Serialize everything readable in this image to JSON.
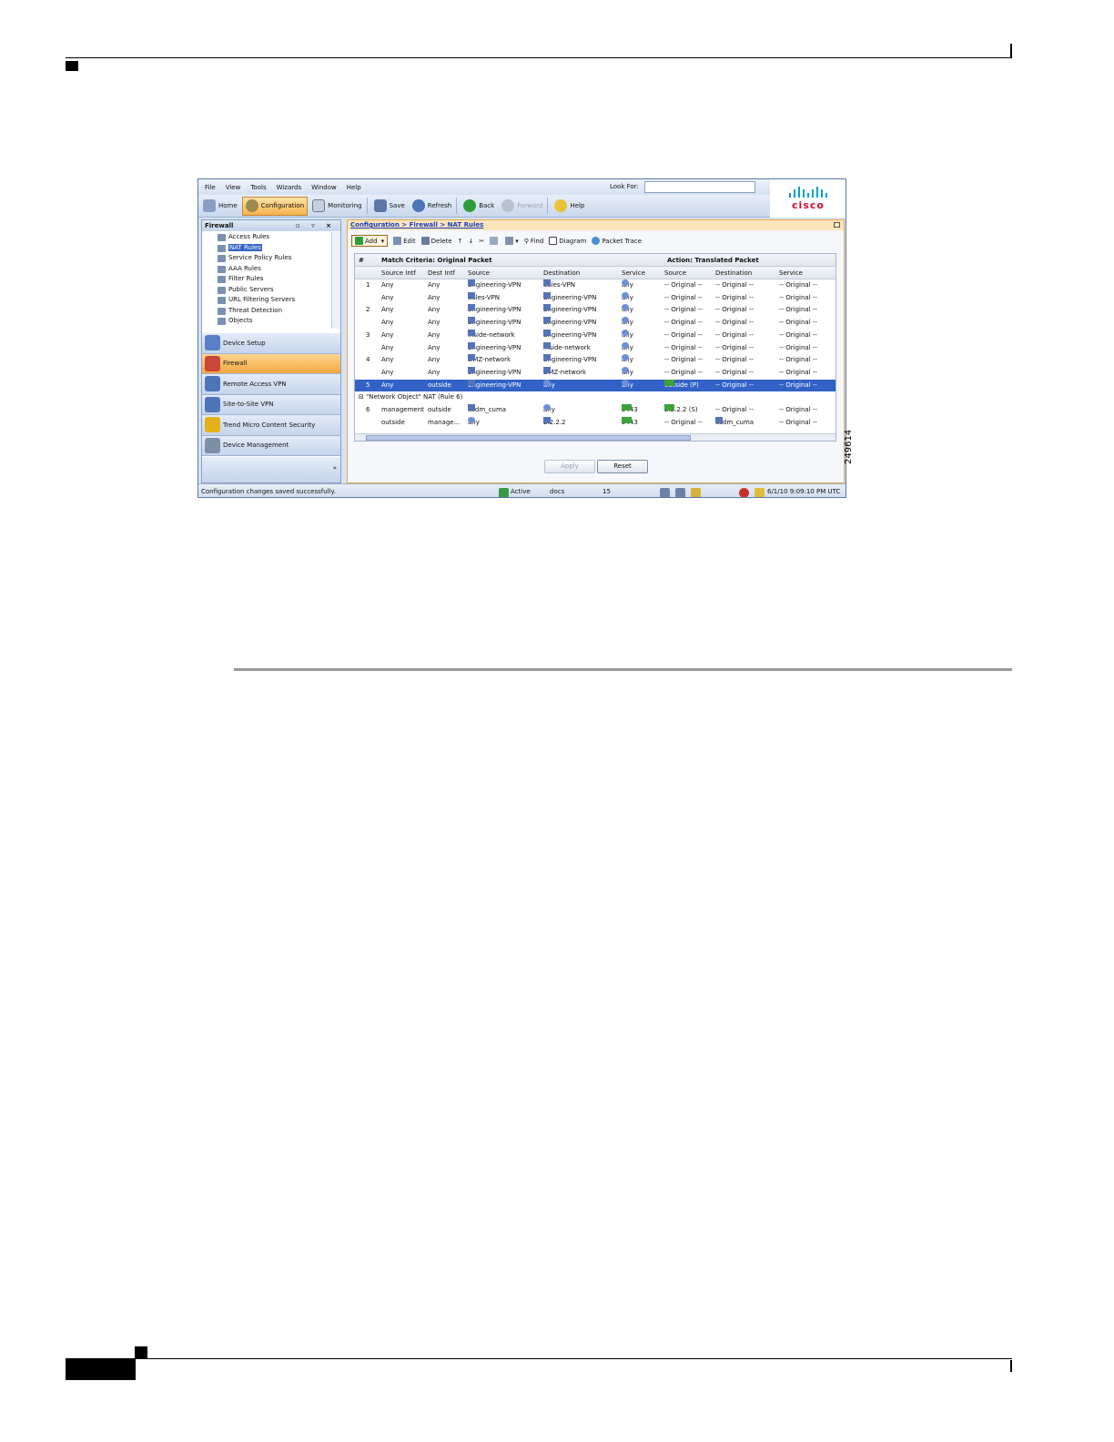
{
  "figure_id": "249614",
  "window": {
    "menu": [
      "File",
      "View",
      "Tools",
      "Wizards",
      "Window",
      "Help"
    ],
    "look_for_label": "Look For:",
    "look_for_value": "",
    "toolbar": {
      "home": "Home",
      "configuration": "Configuration",
      "monitoring": "Monitoring",
      "save": "Save",
      "refresh": "Refresh",
      "back": "Back",
      "forward": "Forward",
      "help": "Help"
    },
    "brand": "cisco",
    "colors": {
      "accent": "#f3b44c",
      "selection": "#3262c7",
      "link": "#1a3fbf",
      "brand_red": "#c8102e",
      "brand_blue": "#049fd9"
    }
  },
  "nav": {
    "title": "Firewall",
    "tree": [
      {
        "label": "Access Rules",
        "icon": "access-rules-icon"
      },
      {
        "label": "NAT Rules",
        "icon": "nat-rules-icon",
        "selected": true
      },
      {
        "label": "Service Policy Rules",
        "icon": "magnifier-icon"
      },
      {
        "label": "AAA Rules",
        "icon": "aaa-icon"
      },
      {
        "label": "Filter Rules",
        "icon": "filter-icon"
      },
      {
        "label": "Public Servers",
        "icon": "server-icon"
      },
      {
        "label": "URL Filtering Servers",
        "icon": "url-filter-icon"
      },
      {
        "label": "Threat Detection",
        "icon": "threat-icon"
      },
      {
        "label": "Objects",
        "icon": "objects-icon"
      }
    ],
    "buttons": [
      {
        "label": "Device Setup",
        "icon": "device-setup-icon",
        "color": "#5a7fc4"
      },
      {
        "label": "Firewall",
        "icon": "firewall-icon",
        "color": "#c9473a",
        "active": true
      },
      {
        "label": "Remote Access VPN",
        "icon": "remote-vpn-icon",
        "color": "#4f75b9"
      },
      {
        "label": "Site-to-Site VPN",
        "icon": "site-vpn-icon",
        "color": "#4f75b9"
      },
      {
        "label": "Trend Micro Content Security",
        "icon": "warning-icon",
        "color": "#e5b21c"
      },
      {
        "label": "Device Management",
        "icon": "device-mgmt-icon",
        "color": "#7f8fa8"
      }
    ],
    "more": "»"
  },
  "main": {
    "breadcrumb": "Configuration > Firewall > NAT Rules",
    "tools": {
      "add": "Add",
      "edit": "Edit",
      "delete": "Delete",
      "find": "Find",
      "diagram": "Diagram",
      "packet_trace": "Packet Trace"
    },
    "headers": {
      "group1": "Match Criteria: Original Packet",
      "group2": "Action: Translated Packet",
      "num": "#",
      "columns": [
        "Source Intf",
        "Dest Intf",
        "Source",
        "Destination",
        "Service",
        "Source",
        "Destination",
        "Service"
      ]
    },
    "rows": [
      {
        "num": "1",
        "cells": [
          "Any",
          "Any",
          "Engineering-VPN",
          "Sales-VPN",
          "any",
          "-- Original --",
          "-- Original --",
          "-- Original --"
        ]
      },
      {
        "num": "",
        "cells": [
          "Any",
          "Any",
          "Sales-VPN",
          "Engineering-VPN",
          "any",
          "-- Original --",
          "-- Original --",
          "-- Original --"
        ]
      },
      {
        "num": "2",
        "cells": [
          "Any",
          "Any",
          "Engineering-VPN",
          "Engineering-VPN",
          "any",
          "-- Original --",
          "-- Original --",
          "-- Original --"
        ]
      },
      {
        "num": "",
        "cells": [
          "Any",
          "Any",
          "Engineering-VPN",
          "Engineering-VPN",
          "any",
          "-- Original --",
          "-- Original --",
          "-- Original --"
        ]
      },
      {
        "num": "3",
        "cells": [
          "Any",
          "Any",
          "inside-network",
          "Engineering-VPN",
          "any",
          "-- Original --",
          "-- Original --",
          "-- Original --"
        ]
      },
      {
        "num": "",
        "cells": [
          "Any",
          "Any",
          "Engineering-VPN",
          "inside-network",
          "any",
          "-- Original --",
          "-- Original --",
          "-- Original --"
        ]
      },
      {
        "num": "4",
        "cells": [
          "Any",
          "Any",
          "DMZ-network",
          "Engineering-VPN",
          "any",
          "-- Original --",
          "-- Original --",
          "-- Original --"
        ]
      },
      {
        "num": "",
        "cells": [
          "Any",
          "Any",
          "Engineering-VPN",
          "DMZ-network",
          "any",
          "-- Original --",
          "-- Original --",
          "-- Original --"
        ]
      },
      {
        "num": "5",
        "cells": [
          "Any",
          "outside",
          "Engineering-VPN",
          "any",
          "any",
          "outside (P)",
          "-- Original --",
          "-- Original --"
        ],
        "selected": true
      },
      {
        "group": "\"Network Object\" NAT (Rule 6)"
      },
      {
        "num": "6",
        "cells": [
          "management",
          "outside",
          "asdm_cuma",
          "any",
          "5443",
          "2.2.2.2 (S)",
          "-- Original --",
          "-- Original --"
        ]
      },
      {
        "num": "",
        "cells": [
          "outside",
          "manage...",
          "any",
          "2.2.2.2",
          "5443",
          "-- Original --",
          "asdm_cuma",
          "-- Original --"
        ]
      }
    ],
    "apply": "Apply",
    "reset": "Reset"
  },
  "status": {
    "message": "Configuration changes saved successfully.",
    "state": "Active",
    "user": "docs",
    "value": "15",
    "datetime": "6/1/10 9:09:10 PM UTC"
  }
}
